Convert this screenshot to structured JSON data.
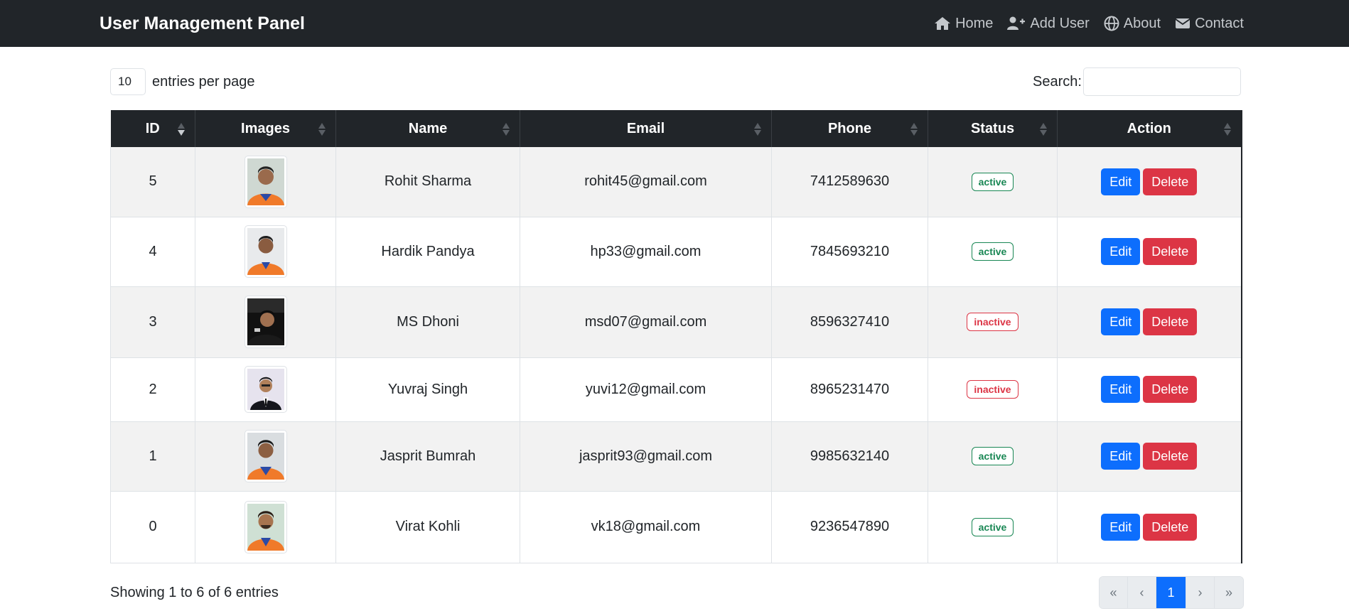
{
  "navbar": {
    "brand": "User Management Panel",
    "links": [
      {
        "label": "Home",
        "icon": "home-icon"
      },
      {
        "label": "Add User",
        "icon": "user-plus-icon"
      },
      {
        "label": "About",
        "icon": "globe-icon"
      },
      {
        "label": "Contact",
        "icon": "envelope-icon"
      }
    ]
  },
  "controls": {
    "entries_value": "10",
    "entries_label": "entries per page",
    "search_label": "Search:"
  },
  "table": {
    "columns": [
      "ID",
      "Images",
      "Name",
      "Email",
      "Phone",
      "Status",
      "Action"
    ],
    "sorted_column": "ID",
    "rows": [
      {
        "id": "5",
        "name": "Rohit Sharma",
        "email": "rohit45@gmail.com",
        "phone": "7412589630",
        "status": "active",
        "edit": "Edit",
        "delete": "Delete"
      },
      {
        "id": "4",
        "name": "Hardik Pandya",
        "email": "hp33@gmail.com",
        "phone": "7845693210",
        "status": "active",
        "edit": "Edit",
        "delete": "Delete"
      },
      {
        "id": "3",
        "name": "MS Dhoni",
        "email": "msd07@gmail.com",
        "phone": "8596327410",
        "status": "inactive",
        "edit": "Edit",
        "delete": "Delete"
      },
      {
        "id": "2",
        "name": "Yuvraj Singh",
        "email": "yuvi12@gmail.com",
        "phone": "8965231470",
        "status": "inactive",
        "edit": "Edit",
        "delete": "Delete"
      },
      {
        "id": "1",
        "name": "Jasprit Bumrah",
        "email": "jasprit93@gmail.com",
        "phone": "9985632140",
        "status": "active",
        "edit": "Edit",
        "delete": "Delete"
      },
      {
        "id": "0",
        "name": "Virat Kohli",
        "email": "vk18@gmail.com",
        "phone": "9236547890",
        "status": "active",
        "edit": "Edit",
        "delete": "Delete"
      }
    ]
  },
  "footer": {
    "info": "Showing 1 to 6 of 6 entries",
    "pagination": {
      "first": "«",
      "prev": "‹",
      "current": "1",
      "next": "›",
      "last": "»"
    }
  },
  "colors": {
    "navbar_bg": "#212529",
    "primary": "#0d6efd",
    "danger": "#dc3545",
    "success": "#198754",
    "stripe": "#f2f2f2"
  }
}
